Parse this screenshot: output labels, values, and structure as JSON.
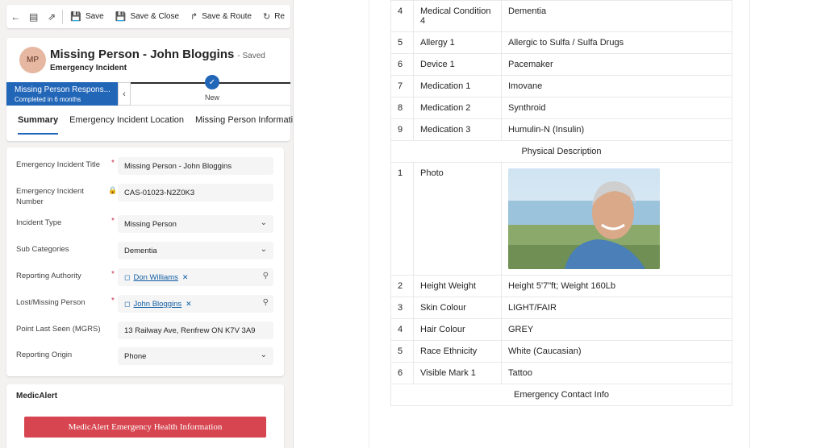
{
  "toolbar": {
    "save": "Save",
    "save_close": "Save & Close",
    "save_route": "Save & Route",
    "refresh": "Re"
  },
  "header": {
    "avatar": "MP",
    "title": "Missing Person - John Bloggins",
    "saved": "- Saved",
    "entity": "Emergency Incident"
  },
  "bpf": {
    "stage": "Missing Person Respons...",
    "completed": "Completed in 6 months",
    "next_stage": "New"
  },
  "tabs": [
    "Summary",
    "Emergency Incident Location",
    "Missing Person Informati"
  ],
  "form": {
    "fields": [
      {
        "label": "Emergency Incident Title",
        "value": "Missing Person - John Bloggins"
      },
      {
        "label": "Emergency Incident Number",
        "value": "CAS-01023-N2Z0K3"
      },
      {
        "label": "Incident Type",
        "value": "Missing Person"
      },
      {
        "label": "Sub Categories",
        "value": "Dementia"
      },
      {
        "label": "Reporting Authority",
        "value": "Don Williams"
      },
      {
        "label": "Lost/Missing Person",
        "value": "John Bloggins"
      },
      {
        "label": "Point Last Seen (MGRS)",
        "value": "13 Railway Ave, Renfrew ON K7V 3A9"
      },
      {
        "label": "Reporting Origin",
        "value": "Phone"
      }
    ]
  },
  "medic": {
    "title": "MedicAlert",
    "button": "MedicAlert Emergency Health Information"
  },
  "doc": {
    "rows": [
      {
        "n": "4",
        "k": "Medical Condition 4",
        "v": "Dementia"
      },
      {
        "n": "5",
        "k": "Allergy 1",
        "v": "Allergic to Sulfa / Sulfa Drugs"
      },
      {
        "n": "6",
        "k": "Device 1",
        "v": "Pacemaker"
      },
      {
        "n": "7",
        "k": "Medication 1",
        "v": "Imovane"
      },
      {
        "n": "8",
        "k": "Medication 2",
        "v": "Synthroid"
      },
      {
        "n": "9",
        "k": "Medication 3",
        "v": "Humulin-N (Insulin)"
      }
    ],
    "section_physical": "Physical Description",
    "photo": {
      "n": "1",
      "k": "Photo"
    },
    "physical_rows": [
      {
        "n": "2",
        "k": "Height Weight",
        "v": "Height 5'7\"ft; Weight 160Lb"
      },
      {
        "n": "3",
        "k": "Skin Colour",
        "v": "LIGHT/FAIR"
      },
      {
        "n": "4",
        "k": "Hair Colour",
        "v": "GREY"
      },
      {
        "n": "5",
        "k": "Race Ethnicity",
        "v": "White (Caucasian)"
      },
      {
        "n": "6",
        "k": "Visible Mark 1",
        "v": "Tattoo"
      }
    ],
    "section_contact": "Emergency Contact Info"
  }
}
